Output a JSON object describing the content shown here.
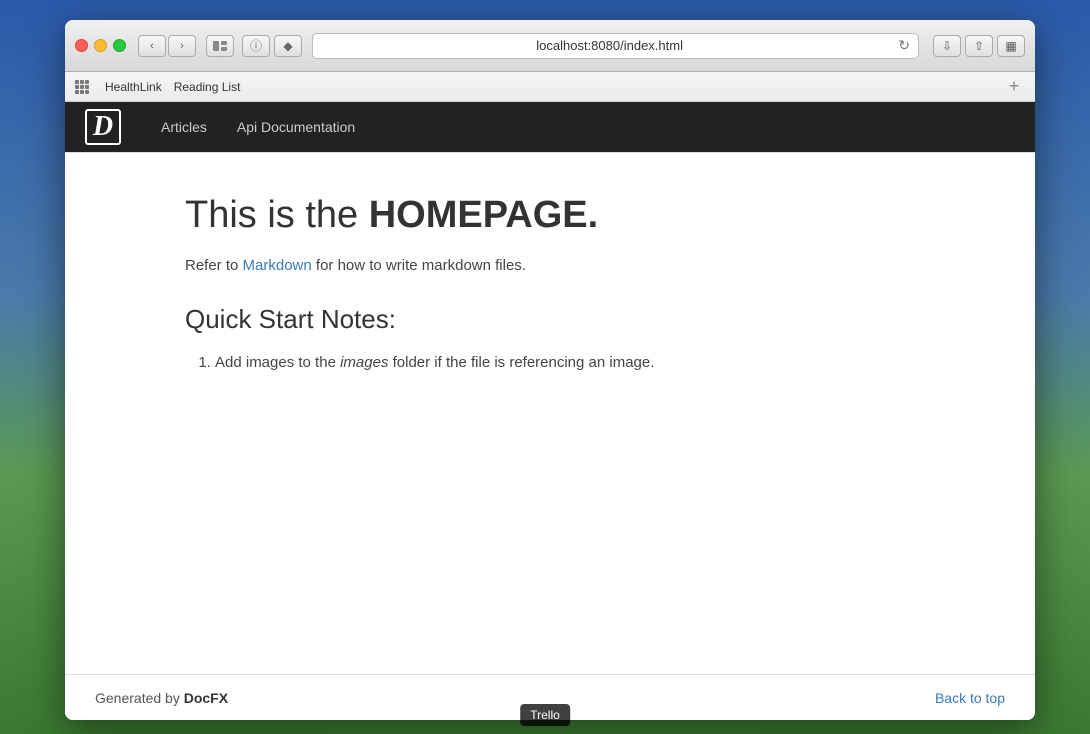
{
  "desktop": {
    "tooltip": "Trello"
  },
  "browser": {
    "address": {
      "base": "localhost:8080",
      "path": "/index.html",
      "full": "localhost:8080/index.html"
    },
    "bookmarks": [
      {
        "label": "HealthLink"
      },
      {
        "label": "Reading List"
      }
    ]
  },
  "navbar": {
    "brand": "D",
    "links": [
      {
        "label": "Articles"
      },
      {
        "label": "Api Documentation"
      }
    ]
  },
  "page": {
    "title_prefix": "This is the ",
    "title_bold": "HOMEPAGE.",
    "subtitle_prefix": "Refer to ",
    "subtitle_link": "Markdown",
    "subtitle_suffix": " for how to write markdown files.",
    "section_heading": "Quick Start Notes:",
    "list_items": [
      {
        "prefix": "Add images to the ",
        "italic": "images",
        "suffix": " folder if the file is referencing an image."
      }
    ]
  },
  "footer": {
    "generated_prefix": "Generated by ",
    "generated_brand": "DocFX",
    "back_to_top": "Back to top"
  }
}
